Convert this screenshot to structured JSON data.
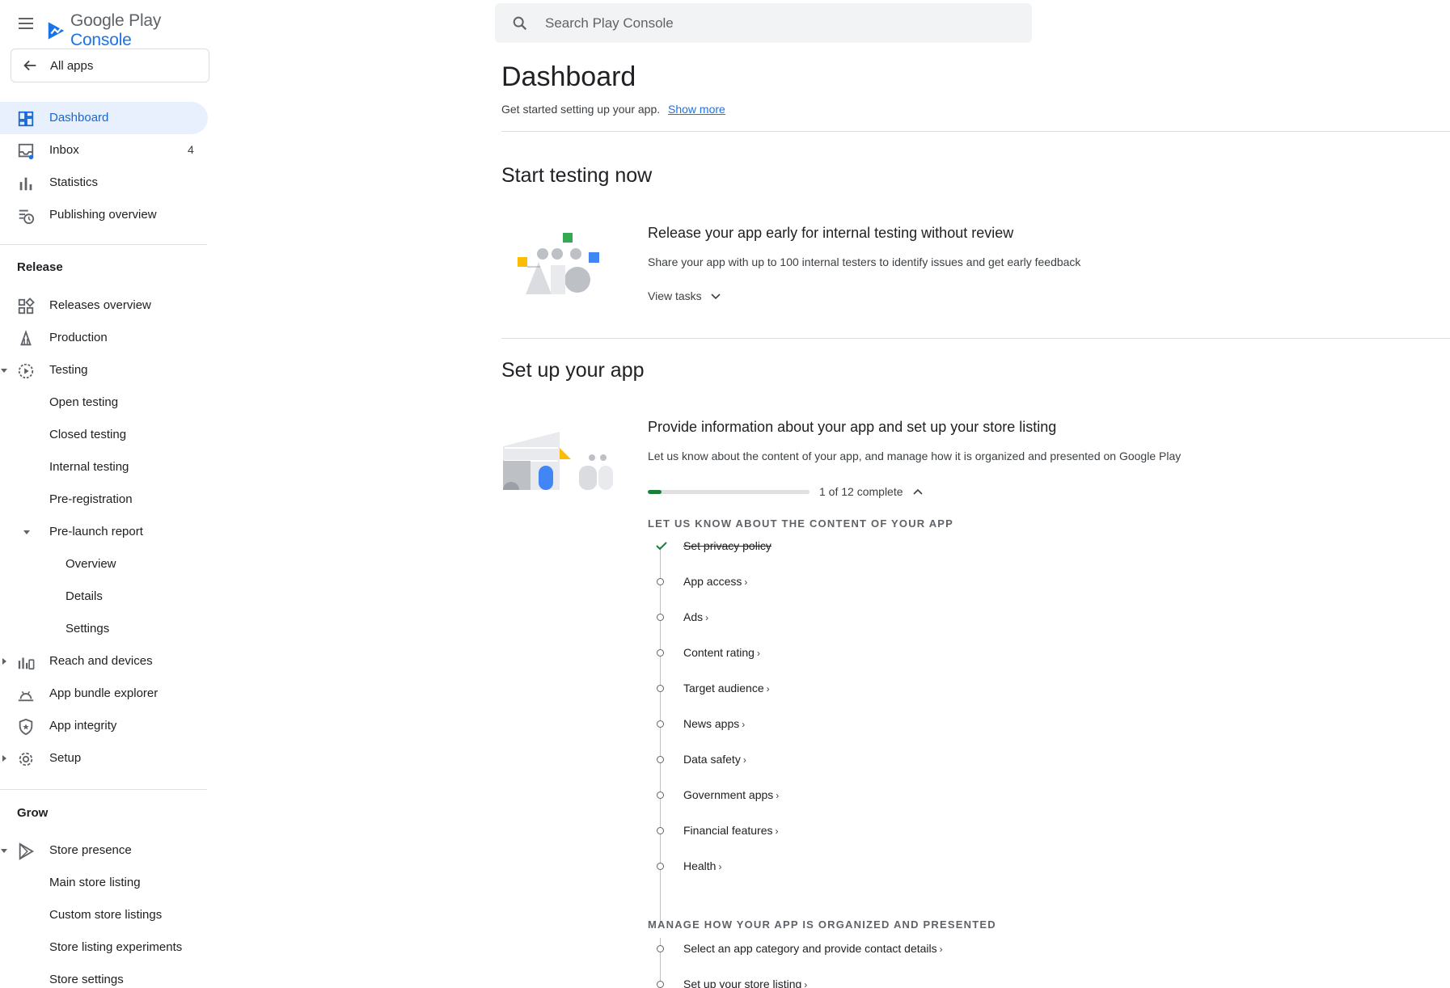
{
  "app": {
    "brand_google_play": "Google Play",
    "brand_console": "Console"
  },
  "sidebar": {
    "all_apps": "All apps",
    "top_items": [
      {
        "label": "Dashboard",
        "icon": "dashboard-icon"
      },
      {
        "label": "Inbox",
        "icon": "inbox-icon",
        "count": "4"
      },
      {
        "label": "Statistics",
        "icon": "bar-chart-icon"
      },
      {
        "label": "Publishing overview",
        "icon": "publishing-overview-icon"
      }
    ],
    "release_label": "Release",
    "release_items": [
      {
        "label": "Releases overview",
        "icon": "releases-overview-icon"
      },
      {
        "label": "Production",
        "icon": "production-icon"
      },
      {
        "label": "Testing",
        "icon": "testing-icon"
      },
      {
        "label": "Open testing"
      },
      {
        "label": "Closed testing"
      },
      {
        "label": "Internal testing"
      },
      {
        "label": "Pre-registration"
      },
      {
        "label": "Pre-launch report"
      },
      {
        "label": "Overview"
      },
      {
        "label": "Details"
      },
      {
        "label": "Settings"
      },
      {
        "label": "Reach and devices",
        "icon": "reach-devices-icon"
      },
      {
        "label": "App bundle explorer",
        "icon": "app-bundle-icon"
      },
      {
        "label": "App integrity",
        "icon": "shield-icon"
      },
      {
        "label": "Setup",
        "icon": "gear-icon"
      }
    ],
    "grow_label": "Grow",
    "grow_items": [
      {
        "label": "Store presence",
        "icon": "store-presence-icon"
      },
      {
        "label": "Main store listing"
      },
      {
        "label": "Custom store listings"
      },
      {
        "label": "Store listing experiments"
      },
      {
        "label": "Store settings"
      }
    ]
  },
  "search": {
    "placeholder": "Search Play Console"
  },
  "main": {
    "title": "Dashboard",
    "subtitle": "Get started setting up your app.",
    "show_more": "Show more",
    "testing_section": {
      "heading": "Start testing now",
      "card_title": "Release your app early for internal testing without review",
      "card_desc": "Share your app with up to 100 internal testers to identify issues and get early feedback",
      "view_tasks": "View tasks"
    },
    "setup_section": {
      "heading": "Set up your app",
      "card_title": "Provide information about your app and set up your store listing",
      "card_desc": "Let us know about the content of your app, and manage how it is organized and presented on Google Play",
      "progress_text": "1 of 12 complete",
      "progress_fraction": 0.083,
      "group1_label": "LET US KNOW ABOUT THE CONTENT OF YOUR APP",
      "group1_tasks": [
        {
          "label": "Set privacy policy",
          "done": true
        },
        {
          "label": "App access",
          "done": false
        },
        {
          "label": "Ads",
          "done": false
        },
        {
          "label": "Content rating",
          "done": false
        },
        {
          "label": "Target audience",
          "done": false
        },
        {
          "label": "News apps",
          "done": false
        },
        {
          "label": "Data safety",
          "done": false
        },
        {
          "label": "Government apps",
          "done": false
        },
        {
          "label": "Financial features",
          "done": false
        },
        {
          "label": "Health",
          "done": false
        }
      ],
      "group2_label": "MANAGE HOW YOUR APP IS ORGANIZED AND PRESENTED",
      "group2_tasks": [
        {
          "label": "Select an app category and provide contact details",
          "done": false
        },
        {
          "label": "Set up your store listing",
          "done": false
        }
      ]
    }
  },
  "colors": {
    "accent": "#1a73e8",
    "active_bg": "#e8f0fe",
    "progress": "#188038"
  }
}
